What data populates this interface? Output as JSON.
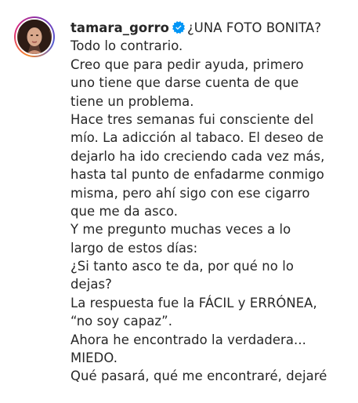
{
  "post": {
    "username": "tamara_gorro",
    "verified_icon": "verified-badge-icon",
    "accent_color": "#0095f6",
    "caption_lines": [
      "¿UNA FOTO BONITA?",
      "Todo lo contrario.",
      "Creo que para pedir ayuda, primero",
      "uno tiene que darse cuenta de que",
      "tiene un problema.",
      "Hace tres semanas fui consciente del",
      "mío. La adicción al tabaco. El deseo de",
      "dejarlo ha ido creciendo cada vez más,",
      "hasta tal punto de enfadarme conmigo",
      "misma, pero ahí sigo con ese cigarro",
      "que me da asco.",
      "Y me pregunto muchas veces a lo",
      "largo de estos días:",
      "¿Si tanto asco te da, por qué no lo",
      "dejas?",
      "La respuesta fue la FÁCIL y ERRÓNEA,",
      "“no soy capaz”.",
      "Ahora he encontrado la verdadera...",
      "MIEDO.",
      "Qué pasará, qué me encontraré, dejaré"
    ]
  }
}
